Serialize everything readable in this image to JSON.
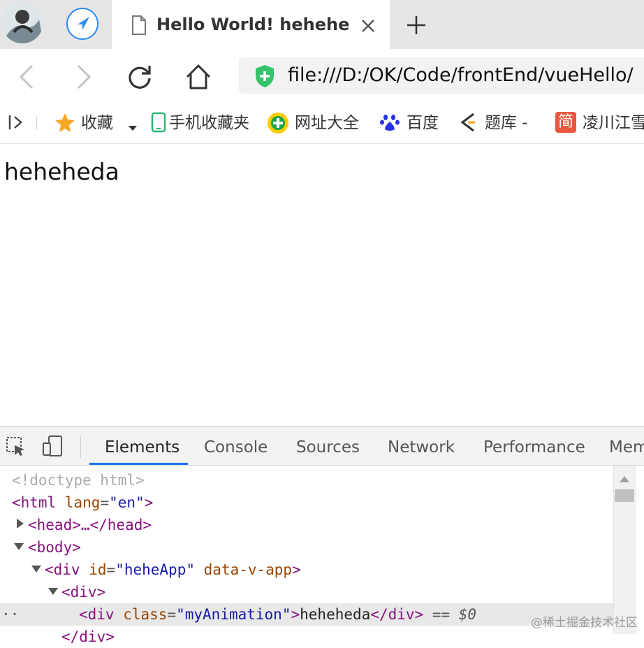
{
  "tab": {
    "title": "Hello World! hehehe",
    "close_icon": "close-icon",
    "new_tab_icon": "plus-icon"
  },
  "toolbar": {
    "url": "file:///D:/OK/Code/frontEnd/vueHello/"
  },
  "bookmarks": {
    "items": [
      {
        "label": "收藏",
        "icon": "star-icon"
      },
      {
        "label": "手机收藏夹",
        "icon": "phone-icon"
      },
      {
        "label": "网址大全",
        "icon": "directory-icon"
      },
      {
        "label": "百度",
        "icon": "baidu-paw-icon"
      },
      {
        "label": "题库 -",
        "icon": "tiku-icon"
      },
      {
        "label": "凌川江雪",
        "icon": "jian-icon",
        "icon_text": "简"
      }
    ]
  },
  "page": {
    "content_text": "heheheda"
  },
  "devtools": {
    "tabs": [
      "Elements",
      "Console",
      "Sources",
      "Network",
      "Performance",
      "Mem"
    ],
    "active_tab": "Elements",
    "dom": {
      "doctype": "<!doctype html>",
      "html_open": "<html",
      "html_lang_attr": "lang",
      "html_lang_val": "\"en\"",
      "head_collapsed": "<head>…</head>",
      "body_open": "<body>",
      "div_app_tag": "<div",
      "div_app_id_attr": "id",
      "div_app_id_val": "\"heheApp\"",
      "div_app_data_attr": "data-v-app",
      "div_inner": "<div>",
      "sel_tag": "<div",
      "sel_class_attr": "class",
      "sel_class_val": "\"myAnimation\"",
      "sel_text": "heheheda",
      "sel_close": "</div>",
      "sel_marker": "== $0",
      "partial_close": "</div>"
    }
  },
  "watermark": "@稀土掘金技术社区",
  "colors": {
    "accent": "#1a73e8",
    "tag": "#881280",
    "attr_name": "#994500",
    "attr_value": "#1a1aa6"
  }
}
